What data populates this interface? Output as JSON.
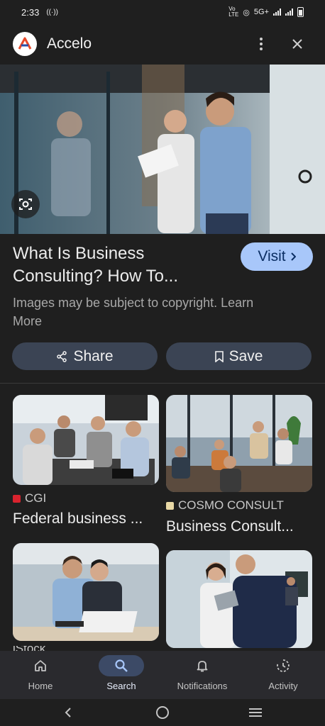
{
  "status_bar": {
    "time": "2:33",
    "network": "5G+"
  },
  "app": {
    "title": "Accelo",
    "brand_color": "#e84a2b"
  },
  "header_actions": {
    "more_icon": "more-vert-icon",
    "close_icon": "close-icon"
  },
  "result": {
    "title_line1": "What Is Business",
    "title_line2": "Consulting? How To...",
    "visit_label": "Visit",
    "copyright_line1": "Images may be subject to copyright. Learn",
    "copyright_line2": "More",
    "share_label": "Share",
    "save_label": "Save"
  },
  "related": [
    {
      "source": "CGI",
      "title": "Federal business ..."
    },
    {
      "source": "COSMO CONSULT",
      "title": "Business Consult..."
    },
    {
      "source": "iStock",
      "title": ""
    },
    {
      "source": "",
      "title": ""
    }
  ],
  "bottom_nav": [
    {
      "label": "Home",
      "icon": "home-icon"
    },
    {
      "label": "Search",
      "icon": "search-icon",
      "active": true
    },
    {
      "label": "Notifications",
      "icon": "bell-icon"
    },
    {
      "label": "Activity",
      "icon": "activity-icon"
    }
  ],
  "colors": {
    "accent": "#a8c7fa",
    "pill_bg": "#3b4454",
    "background": "#1f1f1f"
  }
}
